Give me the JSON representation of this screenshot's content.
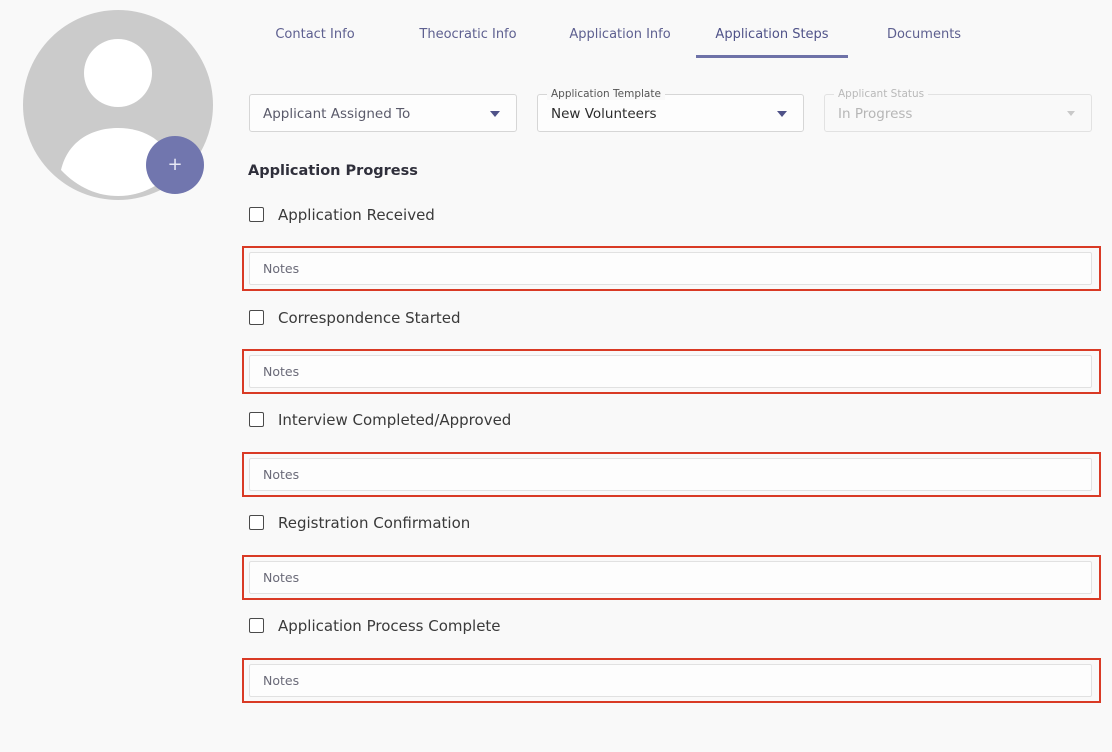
{
  "avatar": {
    "add_label": "+"
  },
  "tabs": [
    {
      "label": "Contact Info"
    },
    {
      "label": "Theocratic Info"
    },
    {
      "label": "Application Info"
    },
    {
      "label": "Application Steps",
      "active": true
    },
    {
      "label": "Documents"
    }
  ],
  "filters": {
    "assigned_to": {
      "placeholder": "Applicant Assigned To"
    },
    "template": {
      "legend": "Application Template",
      "value": "New Volunteers"
    },
    "status": {
      "legend": "Applicant Status",
      "value": "In Progress",
      "disabled": true
    }
  },
  "progress": {
    "title": "Application Progress",
    "steps": [
      {
        "label": "Application Received",
        "checked": false,
        "notes_placeholder": "Notes"
      },
      {
        "label": "Correspondence Started",
        "checked": false,
        "notes_placeholder": "Notes"
      },
      {
        "label": "Interview Completed/Approved",
        "checked": false,
        "notes_placeholder": "Notes"
      },
      {
        "label": "Registration Confirmation",
        "checked": false,
        "notes_placeholder": "Notes"
      },
      {
        "label": "Application Process Complete",
        "checked": false,
        "notes_placeholder": "Notes"
      }
    ]
  },
  "colors": {
    "accent": "#7176ae",
    "tab_text": "#5e6090",
    "highlight_border": "#d93a25",
    "avatar_bg": "#cbcbcb"
  }
}
